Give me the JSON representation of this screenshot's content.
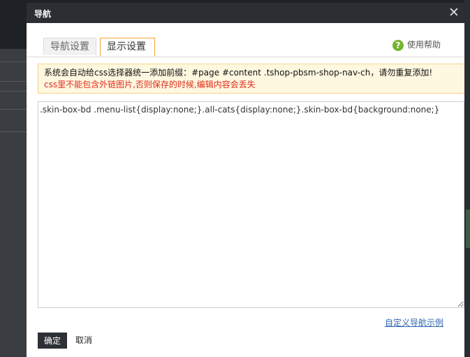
{
  "dialog": {
    "title": "导航",
    "close_icon": "close-icon",
    "close_glyph": "✕"
  },
  "tabs": [
    {
      "label": "导航设置",
      "active": false
    },
    {
      "label": "显示设置",
      "active": true
    }
  ],
  "help": {
    "icon": "help-icon",
    "glyph": "?",
    "label": "使用帮助"
  },
  "notice": {
    "line1": "系统会自动给css选择器统一添加前缀：#page #content .tshop-pbsm-shop-nav-ch，请勿重复添加!",
    "line2": "css里不能包含外链图片,否则保存的时候,编辑内容会丢失"
  },
  "editor": {
    "value": ".skin-box-bd .menu-list{display:none;}.all-cats{display:none;}.skin-box-bd{background:none;}"
  },
  "links": {
    "custom_nav_example": "自定义导航示例"
  },
  "buttons": {
    "ok": "确定",
    "cancel": "取消"
  },
  "colors": {
    "titlebar": "#2b2e33",
    "active_tab_border": "#f0a43a",
    "notice_bg": "#fff8e0",
    "warning_text": "#e02a1a",
    "link": "#2f67b1",
    "help_icon": "#74b52f"
  }
}
